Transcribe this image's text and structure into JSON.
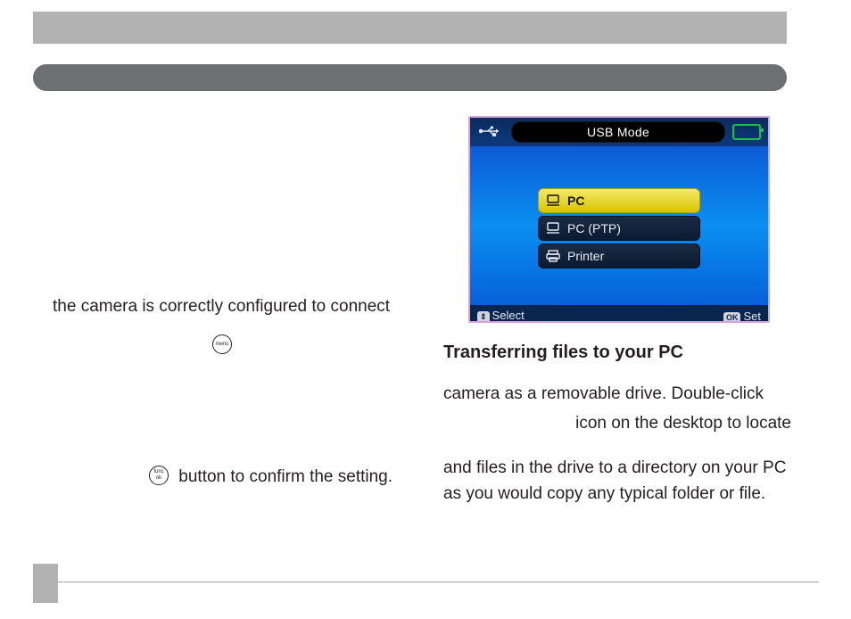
{
  "left": {
    "line1": "the camera is correctly conﬁgured to connect",
    "line_after_menu": "",
    "confirm_suffix": " button to conﬁrm the setting."
  },
  "right": {
    "heading": "Transferring ﬁles to your PC",
    "para1_line1": "camera as a removable drive. Double-click",
    "para1_line2": "icon on the desktop to locate",
    "para2": "and ﬁles in the drive to a directory on your PC as you would copy any typical folder or ﬁle."
  },
  "screen": {
    "title": "USB Mode",
    "items": [
      {
        "label": "PC",
        "selected": true
      },
      {
        "label": "PC (PTP)",
        "selected": false
      },
      {
        "label": "Printer",
        "selected": false
      }
    ],
    "footer_left_key": "⇕",
    "footer_left": "Select",
    "footer_right_key": "OK",
    "footer_right": "Set"
  }
}
